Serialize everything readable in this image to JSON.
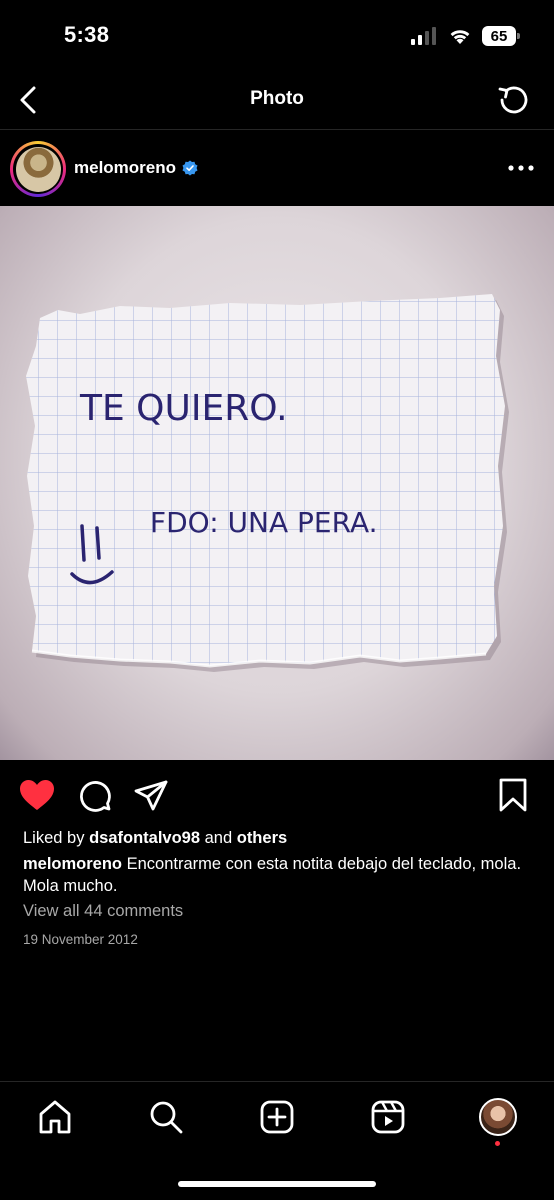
{
  "status_bar": {
    "time": "5:38",
    "battery": "65"
  },
  "header": {
    "title": "Photo"
  },
  "post": {
    "username": "melomoreno",
    "verified": true,
    "photo": {
      "note_line1": "TE QUIERO.",
      "note_line2": "FDO: UNA PERA."
    },
    "likes_prefix": "Liked by",
    "likes_user": "dsafontalvo98",
    "likes_joiner": "and",
    "likes_suffix": "others",
    "caption_user": "melomoreno",
    "caption_text": "Encontrarme con esta notita debajo del teclado, mola. Mola mucho.",
    "view_comments": "View all 44 comments",
    "date": "19 November 2012",
    "liked": true
  },
  "icons": {
    "back": "chevron-left-icon",
    "refresh": "refresh-icon",
    "more": "more-horizontal-icon",
    "like": "heart-filled-icon",
    "comment": "comment-icon",
    "share": "send-icon",
    "save": "bookmark-icon"
  },
  "colors": {
    "like": "#ff3040",
    "verified": "#3897f0",
    "muted": "#a8a8a8"
  },
  "bottom_nav": [
    "home",
    "search",
    "create",
    "reels",
    "profile"
  ]
}
